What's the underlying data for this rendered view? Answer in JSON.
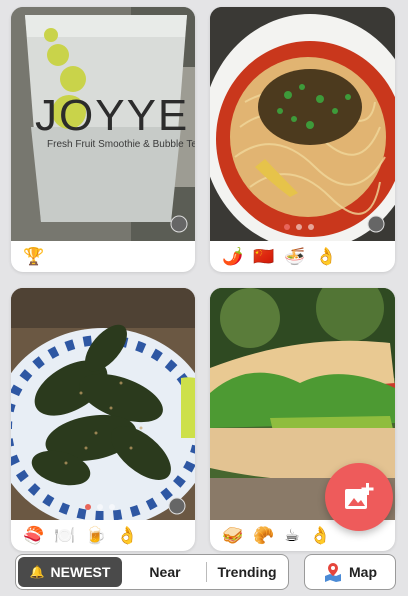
{
  "feed": {
    "cards": [
      {
        "name": "bubble-tea-card",
        "emojis": [
          "🏆"
        ]
      },
      {
        "name": "noodle-card",
        "emojis": [
          "🌶️",
          "🇨🇳",
          "🍜",
          "👌"
        ]
      },
      {
        "name": "peppers-card",
        "emojis": [
          "🍣",
          "🍽️",
          "🍺",
          "👌"
        ]
      },
      {
        "name": "sandwich-card",
        "emojis": [
          "🥪",
          "🥐",
          "☕",
          "👌"
        ]
      }
    ],
    "cup_text": {
      "brand": "JOYYE",
      "tagline": "Fresh Fruit Smoothie & Bubble Tea"
    }
  },
  "tabs": {
    "newest": "NEWEST",
    "near": "Near",
    "trending": "Trending"
  },
  "map_button": {
    "label": "Map"
  },
  "colors": {
    "accent": "#ee5b5b",
    "active_tab": "#4a4a4a"
  }
}
